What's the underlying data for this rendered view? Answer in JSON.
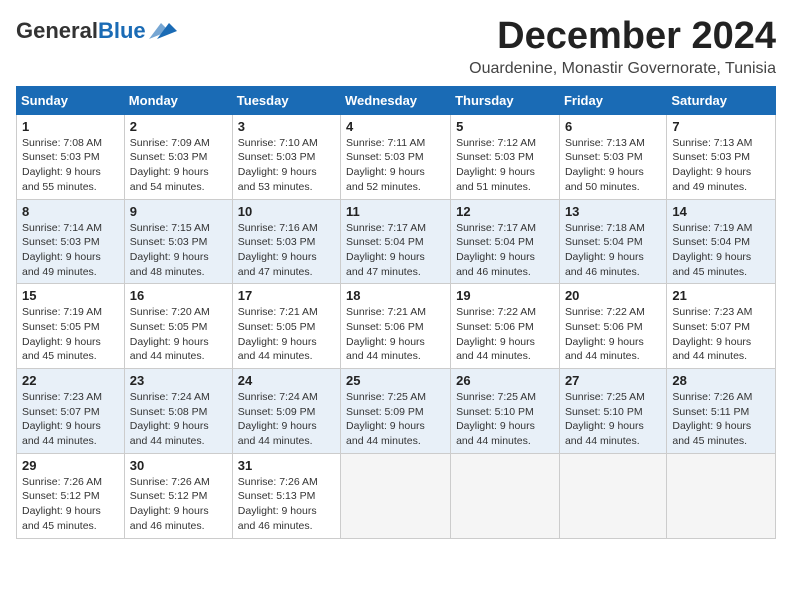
{
  "header": {
    "logo_general": "General",
    "logo_blue": "Blue",
    "month_title": "December 2024",
    "location": "Ouardenine, Monastir Governorate, Tunisia"
  },
  "columns": [
    "Sunday",
    "Monday",
    "Tuesday",
    "Wednesday",
    "Thursday",
    "Friday",
    "Saturday"
  ],
  "weeks": [
    [
      {
        "day": "1",
        "lines": [
          "Sunrise: 7:08 AM",
          "Sunset: 5:03 PM",
          "Daylight: 9 hours",
          "and 55 minutes."
        ]
      },
      {
        "day": "2",
        "lines": [
          "Sunrise: 7:09 AM",
          "Sunset: 5:03 PM",
          "Daylight: 9 hours",
          "and 54 minutes."
        ]
      },
      {
        "day": "3",
        "lines": [
          "Sunrise: 7:10 AM",
          "Sunset: 5:03 PM",
          "Daylight: 9 hours",
          "and 53 minutes."
        ]
      },
      {
        "day": "4",
        "lines": [
          "Sunrise: 7:11 AM",
          "Sunset: 5:03 PM",
          "Daylight: 9 hours",
          "and 52 minutes."
        ]
      },
      {
        "day": "5",
        "lines": [
          "Sunrise: 7:12 AM",
          "Sunset: 5:03 PM",
          "Daylight: 9 hours",
          "and 51 minutes."
        ]
      },
      {
        "day": "6",
        "lines": [
          "Sunrise: 7:13 AM",
          "Sunset: 5:03 PM",
          "Daylight: 9 hours",
          "and 50 minutes."
        ]
      },
      {
        "day": "7",
        "lines": [
          "Sunrise: 7:13 AM",
          "Sunset: 5:03 PM",
          "Daylight: 9 hours",
          "and 49 minutes."
        ]
      }
    ],
    [
      {
        "day": "8",
        "lines": [
          "Sunrise: 7:14 AM",
          "Sunset: 5:03 PM",
          "Daylight: 9 hours",
          "and 49 minutes."
        ]
      },
      {
        "day": "9",
        "lines": [
          "Sunrise: 7:15 AM",
          "Sunset: 5:03 PM",
          "Daylight: 9 hours",
          "and 48 minutes."
        ]
      },
      {
        "day": "10",
        "lines": [
          "Sunrise: 7:16 AM",
          "Sunset: 5:03 PM",
          "Daylight: 9 hours",
          "and 47 minutes."
        ]
      },
      {
        "day": "11",
        "lines": [
          "Sunrise: 7:17 AM",
          "Sunset: 5:04 PM",
          "Daylight: 9 hours",
          "and 47 minutes."
        ]
      },
      {
        "day": "12",
        "lines": [
          "Sunrise: 7:17 AM",
          "Sunset: 5:04 PM",
          "Daylight: 9 hours",
          "and 46 minutes."
        ]
      },
      {
        "day": "13",
        "lines": [
          "Sunrise: 7:18 AM",
          "Sunset: 5:04 PM",
          "Daylight: 9 hours",
          "and 46 minutes."
        ]
      },
      {
        "day": "14",
        "lines": [
          "Sunrise: 7:19 AM",
          "Sunset: 5:04 PM",
          "Daylight: 9 hours",
          "and 45 minutes."
        ]
      }
    ],
    [
      {
        "day": "15",
        "lines": [
          "Sunrise: 7:19 AM",
          "Sunset: 5:05 PM",
          "Daylight: 9 hours",
          "and 45 minutes."
        ]
      },
      {
        "day": "16",
        "lines": [
          "Sunrise: 7:20 AM",
          "Sunset: 5:05 PM",
          "Daylight: 9 hours",
          "and 44 minutes."
        ]
      },
      {
        "day": "17",
        "lines": [
          "Sunrise: 7:21 AM",
          "Sunset: 5:05 PM",
          "Daylight: 9 hours",
          "and 44 minutes."
        ]
      },
      {
        "day": "18",
        "lines": [
          "Sunrise: 7:21 AM",
          "Sunset: 5:06 PM",
          "Daylight: 9 hours",
          "and 44 minutes."
        ]
      },
      {
        "day": "19",
        "lines": [
          "Sunrise: 7:22 AM",
          "Sunset: 5:06 PM",
          "Daylight: 9 hours",
          "and 44 minutes."
        ]
      },
      {
        "day": "20",
        "lines": [
          "Sunrise: 7:22 AM",
          "Sunset: 5:06 PM",
          "Daylight: 9 hours",
          "and 44 minutes."
        ]
      },
      {
        "day": "21",
        "lines": [
          "Sunrise: 7:23 AM",
          "Sunset: 5:07 PM",
          "Daylight: 9 hours",
          "and 44 minutes."
        ]
      }
    ],
    [
      {
        "day": "22",
        "lines": [
          "Sunrise: 7:23 AM",
          "Sunset: 5:07 PM",
          "Daylight: 9 hours",
          "and 44 minutes."
        ]
      },
      {
        "day": "23",
        "lines": [
          "Sunrise: 7:24 AM",
          "Sunset: 5:08 PM",
          "Daylight: 9 hours",
          "and 44 minutes."
        ]
      },
      {
        "day": "24",
        "lines": [
          "Sunrise: 7:24 AM",
          "Sunset: 5:09 PM",
          "Daylight: 9 hours",
          "and 44 minutes."
        ]
      },
      {
        "day": "25",
        "lines": [
          "Sunrise: 7:25 AM",
          "Sunset: 5:09 PM",
          "Daylight: 9 hours",
          "and 44 minutes."
        ]
      },
      {
        "day": "26",
        "lines": [
          "Sunrise: 7:25 AM",
          "Sunset: 5:10 PM",
          "Daylight: 9 hours",
          "and 44 minutes."
        ]
      },
      {
        "day": "27",
        "lines": [
          "Sunrise: 7:25 AM",
          "Sunset: 5:10 PM",
          "Daylight: 9 hours",
          "and 44 minutes."
        ]
      },
      {
        "day": "28",
        "lines": [
          "Sunrise: 7:26 AM",
          "Sunset: 5:11 PM",
          "Daylight: 9 hours",
          "and 45 minutes."
        ]
      }
    ],
    [
      {
        "day": "29",
        "lines": [
          "Sunrise: 7:26 AM",
          "Sunset: 5:12 PM",
          "Daylight: 9 hours",
          "and 45 minutes."
        ]
      },
      {
        "day": "30",
        "lines": [
          "Sunrise: 7:26 AM",
          "Sunset: 5:12 PM",
          "Daylight: 9 hours",
          "and 46 minutes."
        ]
      },
      {
        "day": "31",
        "lines": [
          "Sunrise: 7:26 AM",
          "Sunset: 5:13 PM",
          "Daylight: 9 hours",
          "and 46 minutes."
        ]
      },
      null,
      null,
      null,
      null
    ]
  ]
}
